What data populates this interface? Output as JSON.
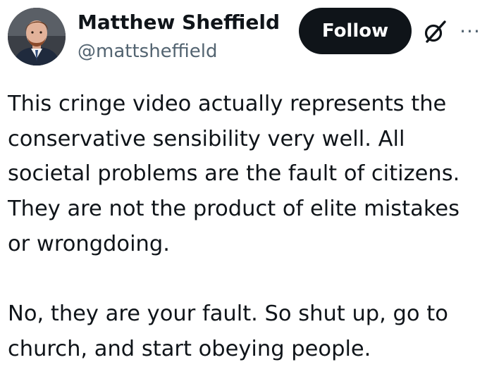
{
  "author": {
    "name": "Matthew Sheffield",
    "handle": "@mattsheffield",
    "avatar_icon": "profile-photo"
  },
  "header": {
    "follow_label": "Follow",
    "grok_icon": "grok-icon",
    "more_icon": "more-icon",
    "more_glyph": "···"
  },
  "tweet": {
    "lines": [
      "This cringe video actually represents the",
      "conservative sensibility very well. All",
      "societal problems are the fault of citizens.",
      "They are not the product of elite mistakes",
      "or wrongdoing.",
      "",
      "No, they are your fault. So shut up, go to",
      "church, and start obeying people."
    ]
  },
  "colors": {
    "text_primary": "#0f1419",
    "text_secondary": "#536471",
    "button_bg": "#0f1419",
    "button_text": "#ffffff"
  }
}
